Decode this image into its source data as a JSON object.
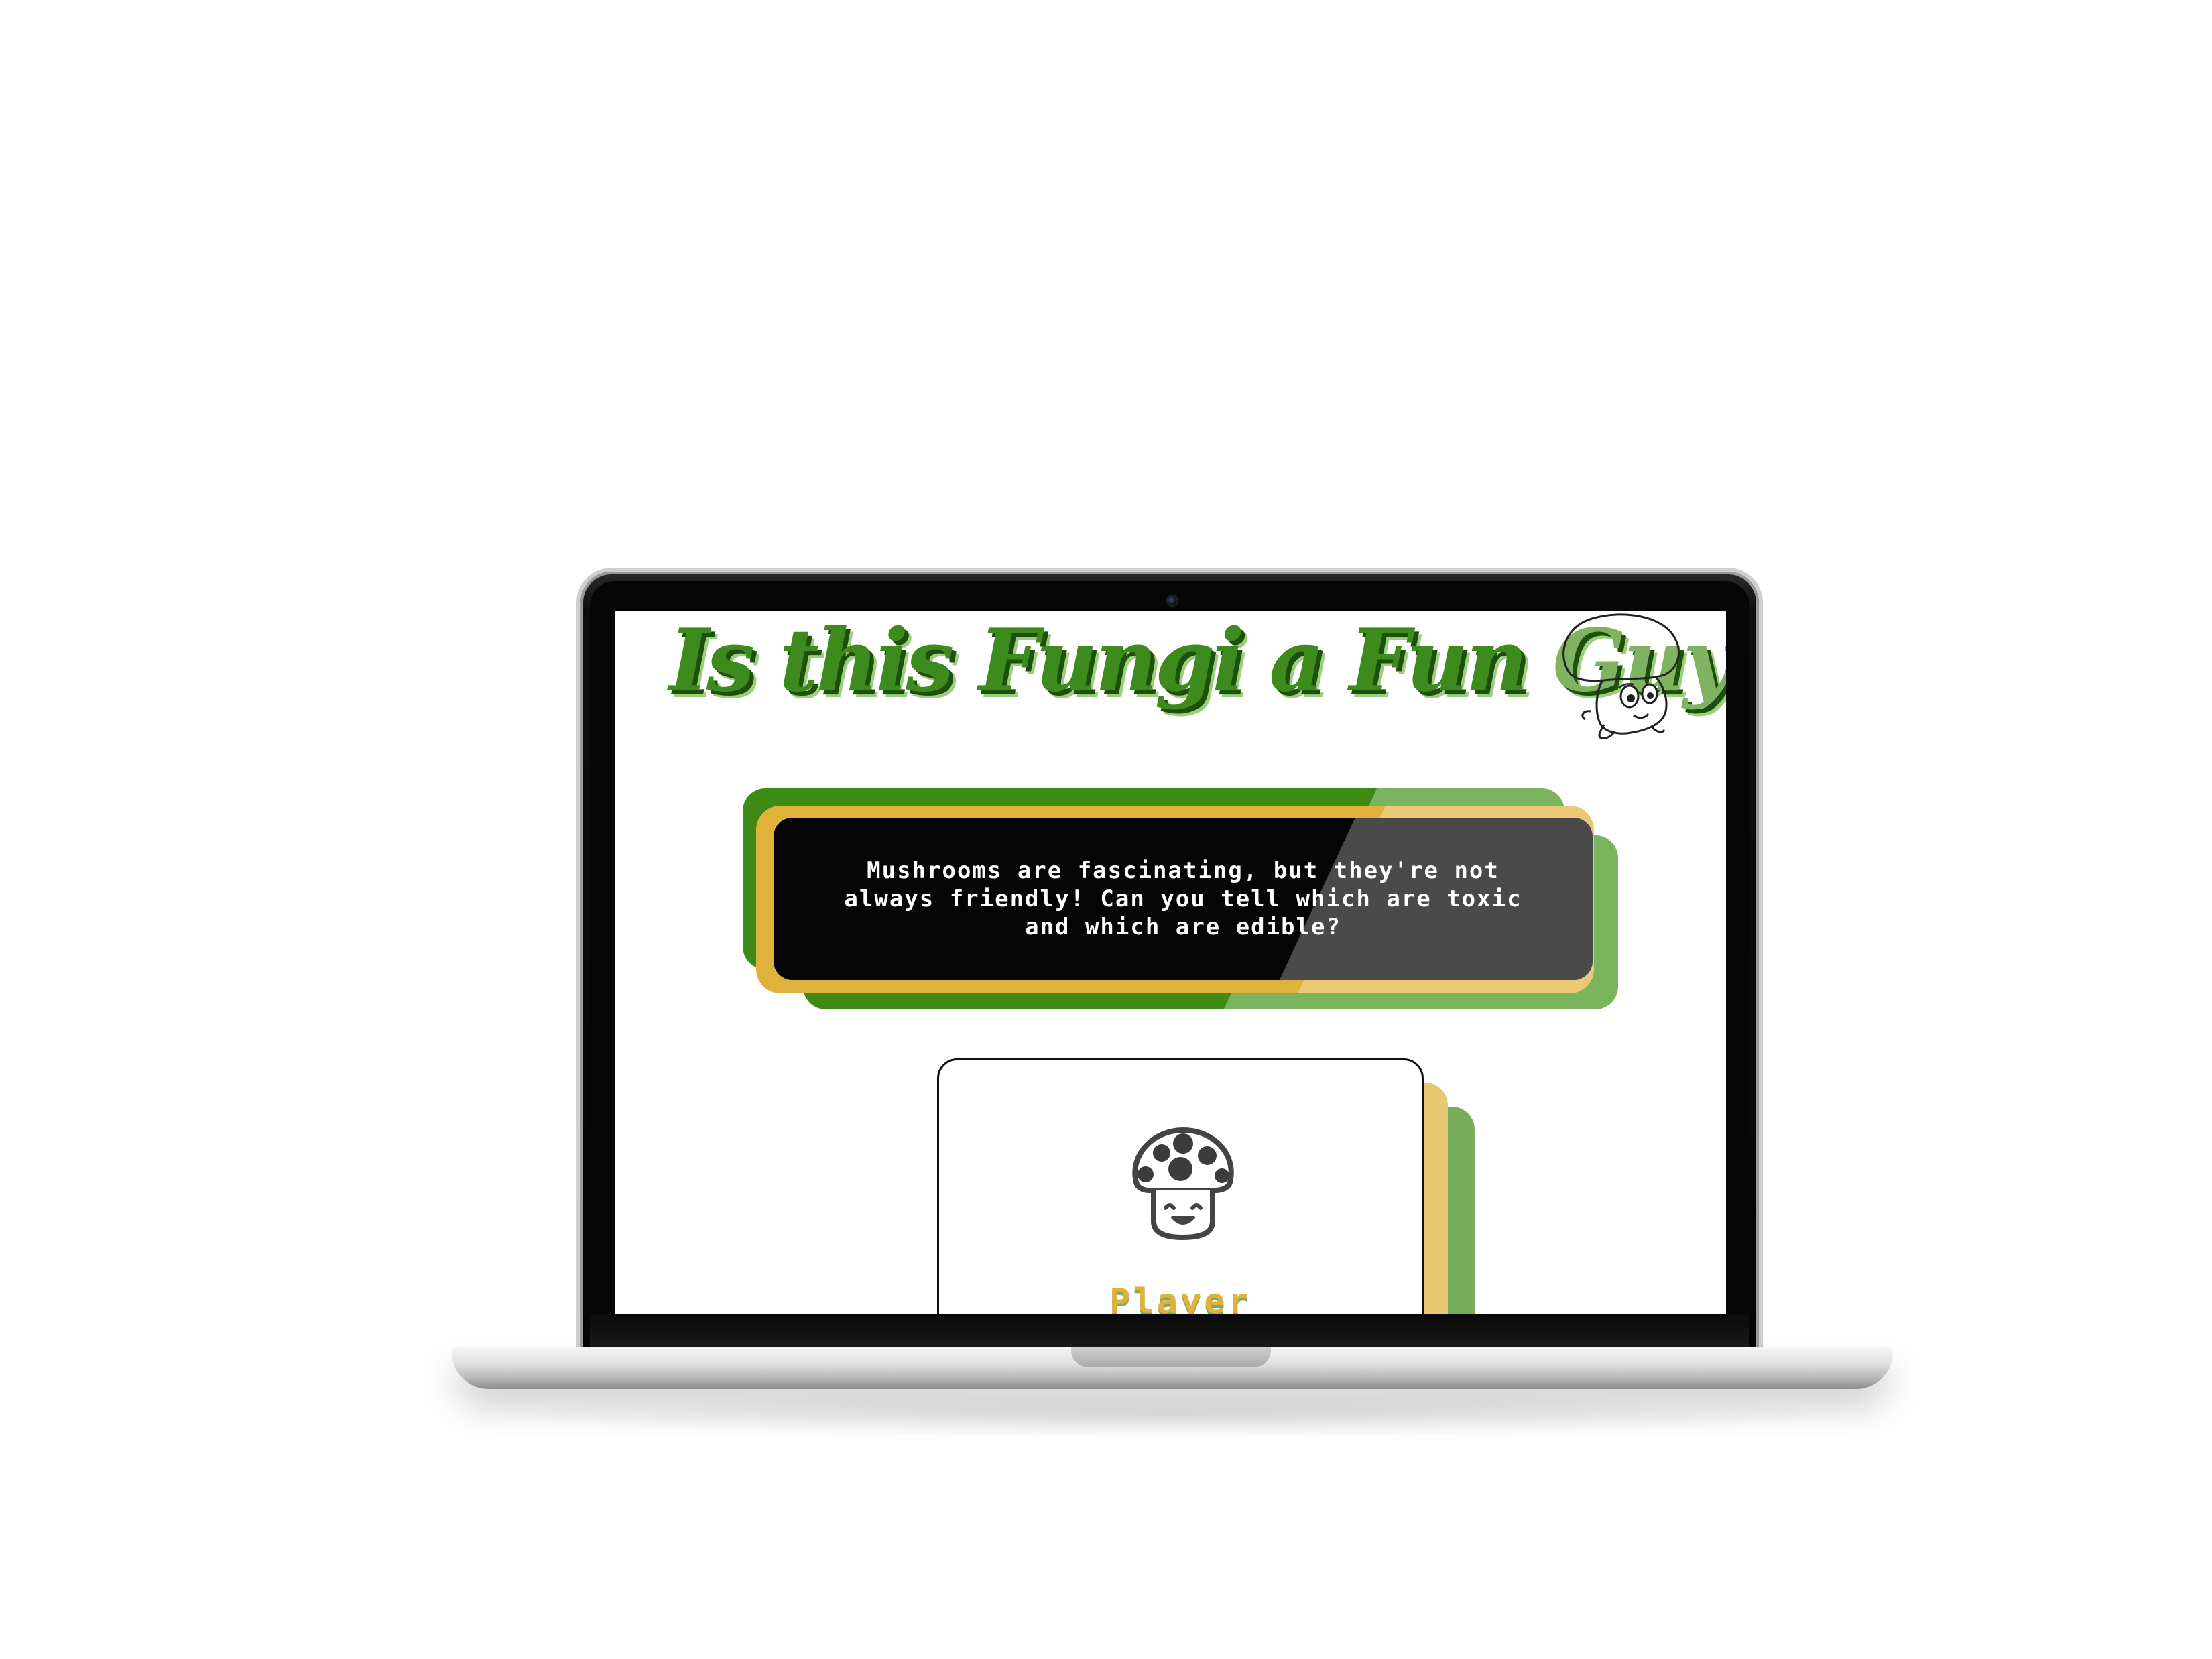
{
  "page": {
    "title_main": "Is this Fungi a Fun ",
    "title_accent": "Guy?"
  },
  "intro": {
    "text": "Mushrooms are fascinating, but they're not always friendly! Can you tell which are toxic and which are edible?"
  },
  "player_card": {
    "label": "Player",
    "icon": "spotted-mushroom-icon"
  },
  "mascot": {
    "icon": "mushroom-mascot-icon"
  },
  "colors": {
    "green_dark": "#3d8a14",
    "green_light": "#7ab45f",
    "yellow": "#e0b13b",
    "yellow_light": "#e9c975",
    "card_dark": "#050505",
    "card_gray": "#4a4a4a"
  }
}
